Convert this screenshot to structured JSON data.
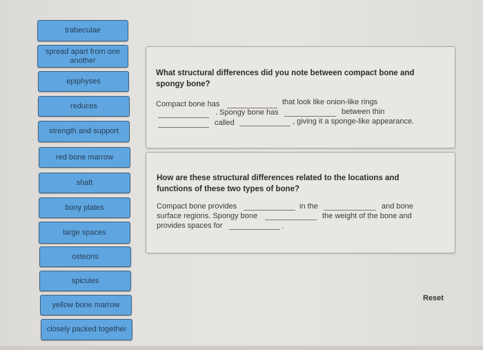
{
  "answer_bank": [
    "trabeculae",
    "spread apart from one another",
    "epiphyses",
    "reduces",
    "strength and support",
    "red bone marrow",
    "shaft",
    "bony plates",
    "large spaces",
    "osteons",
    "spicules",
    "yellow bone marrow",
    "closely packed together"
  ],
  "question1": {
    "prompt": "What structural differences did you note between compact bone and spongy bone?",
    "prompt_line1": "What structural differences did you note between compact bone and",
    "prompt_line2": "spongy bone?",
    "segments": [
      "Compact bone has",
      "that look like onion-like rings",
      ". Spongy bone has",
      "between thin",
      "called",
      ", giving it a sponge-like appearance."
    ],
    "blanks": [
      "",
      "",
      "",
      "",
      ""
    ]
  },
  "question2": {
    "prompt": "How are these structural differences related to the locations and functions of these two types of bone?",
    "prompt_line1": "How are these structural differences related to the locations and",
    "prompt_line2": "functions of these two types of bone?",
    "segments": [
      "Compact bone provides",
      "in the",
      "and bone",
      "surface regions. Spongy bone",
      "the weight of the bone and",
      "provides spaces for",
      "."
    ],
    "blanks": [
      "",
      "",
      "",
      ""
    ]
  },
  "reset_label": "Reset",
  "colors": {
    "chip_fill": "#5fa6e0",
    "chip_border": "#3e5f80",
    "chip_text": "#263d57",
    "background": "#e4e2de"
  }
}
